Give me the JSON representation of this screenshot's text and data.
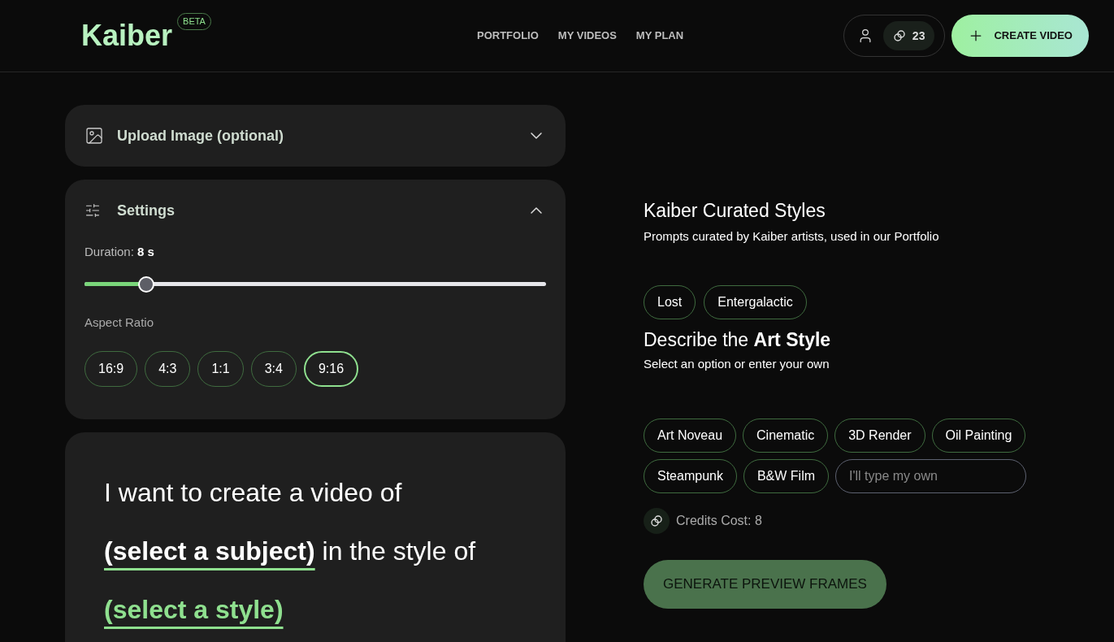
{
  "header": {
    "logo": "Kaiber",
    "badge": "BETA",
    "nav": [
      {
        "label": "PORTFOLIO"
      },
      {
        "label": "MY VIDEOS"
      },
      {
        "label": "MY PLAN"
      }
    ],
    "credits": "23",
    "create_button": "CREATE VIDEO"
  },
  "upload_panel": {
    "title": "Upload Image (optional)",
    "expanded": false
  },
  "settings_panel": {
    "title": "Settings",
    "expanded": true,
    "duration_label": "Duration:",
    "duration_value": "8 s",
    "duration_slider": {
      "level": 0.134
    },
    "aspect_label": "Aspect Ratio",
    "aspect_ratios": [
      {
        "label": "16:9",
        "selected": false
      },
      {
        "label": "4:3",
        "selected": false
      },
      {
        "label": "1:1",
        "selected": false
      },
      {
        "label": "3:4",
        "selected": false
      },
      {
        "label": "9:16",
        "selected": true
      }
    ]
  },
  "prompt": {
    "parts": [
      {
        "kind": "text",
        "text": "I want to create a video of"
      },
      {
        "kind": "subject",
        "text": "(select a subject)"
      },
      {
        "kind": "text",
        "text": "in the style of"
      },
      {
        "kind": "style",
        "text": "(select a style)"
      }
    ]
  },
  "curated": {
    "title": "Kaiber Curated Styles",
    "subtitle": "Prompts curated by Kaiber artists, used in our Portfolio",
    "chips": [
      {
        "label": "Lost"
      },
      {
        "label": "Entergalactic"
      }
    ]
  },
  "art_style": {
    "title": "Describe the **Art Style**",
    "subtitle": "Select an option or enter your own",
    "chips": [
      {
        "label": "Art Noveau"
      },
      {
        "label": "Cinematic"
      },
      {
        "label": "3D Render"
      },
      {
        "label": "Oil Painting"
      },
      {
        "label": "Steampunk"
      },
      {
        "label": "B&W Film"
      }
    ],
    "custom_placeholder": "I'll type my own"
  },
  "credits_cost": "Credits Cost: 8",
  "generate_button": {
    "label": "GENERATE PREVIEW FRAMES",
    "disabled": true
  }
}
